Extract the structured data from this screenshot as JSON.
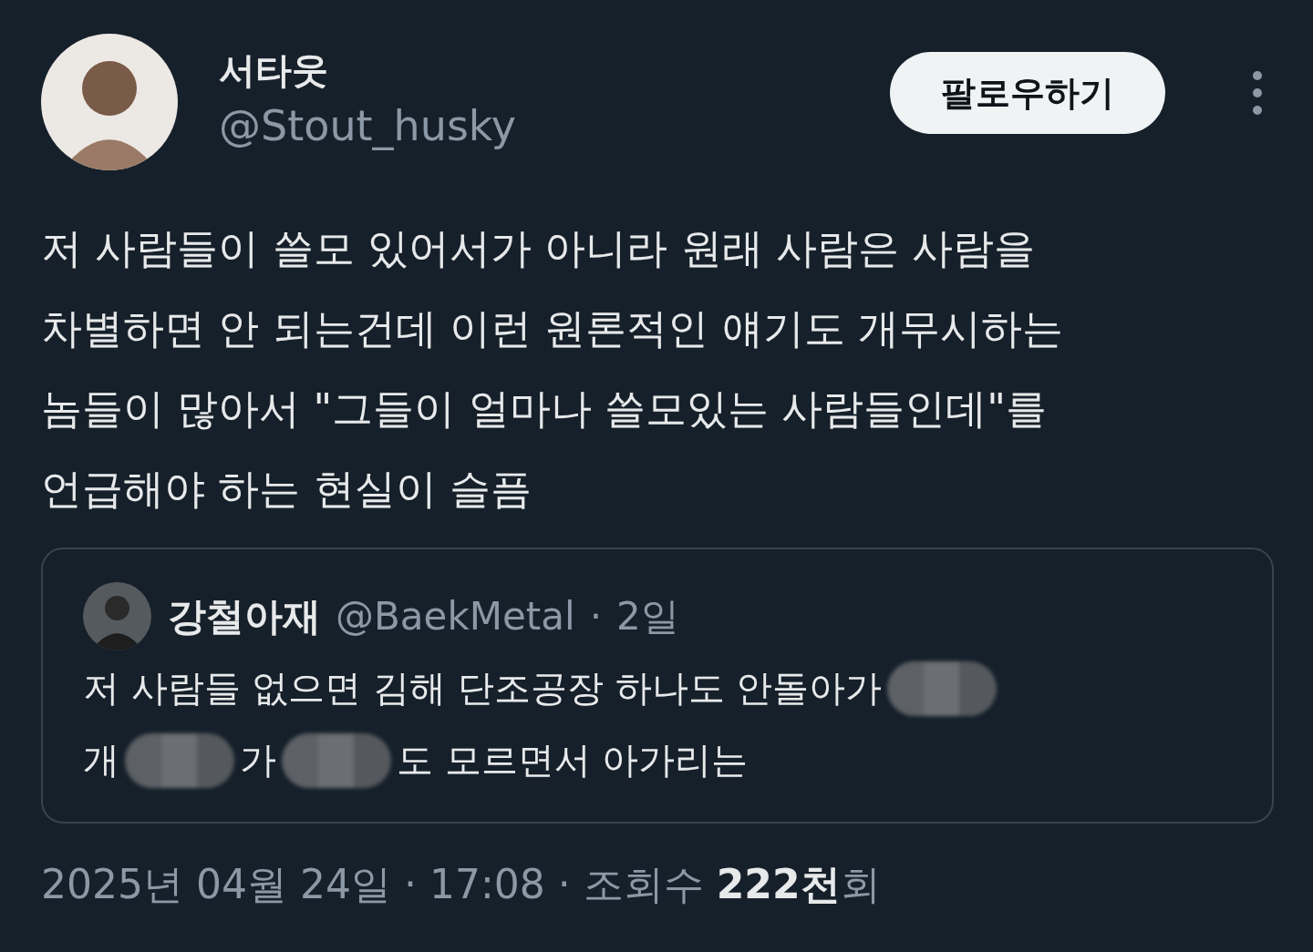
{
  "tweet": {
    "author": {
      "name": "서타웃",
      "handle": "@Stout_husky"
    },
    "follow_button": "팔로우하기",
    "text_lines": [
      "저 사람들이 쓸모 있어서가 아니라 원래 사람은 사람을",
      "차별하면 안 되는건데 이런 원론적인 얘기도 개무시하는",
      "놈들이 많아서 \"그들이 얼마나 쓸모있는 사람들인데\"를",
      "언급해야 하는 현실이 슬픔"
    ],
    "quote": {
      "author": {
        "name": "강철아재",
        "handle": "@BaekMetal",
        "separator": "·",
        "time": "2일"
      },
      "lines": [
        [
          {
            "kind": "text",
            "text": "저 사람들 없으면 김해 단조공장 하나도 안돌아가"
          },
          {
            "kind": "redaction"
          }
        ],
        [
          {
            "kind": "text",
            "text": "개"
          },
          {
            "kind": "redaction"
          },
          {
            "kind": "text",
            "text": "가"
          },
          {
            "kind": "redaction"
          },
          {
            "kind": "text",
            "text": "도 모르면서 아가리는"
          }
        ]
      ]
    },
    "footer": {
      "date": "2025년 04월 24일",
      "separator_1": "·",
      "time": "17:08",
      "separator_2": "·",
      "views_label": "조회수",
      "views_count": "222천",
      "views_unit": "회"
    }
  }
}
